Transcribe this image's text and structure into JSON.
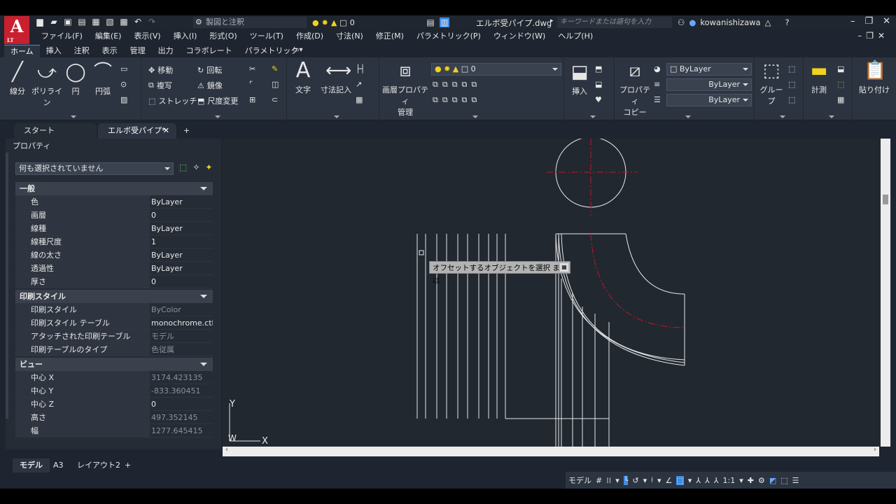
{
  "app": {
    "logo": "A",
    "logo_sub": "LT",
    "workspace": "製図と注釈",
    "layer": "0",
    "file_name": "エルボ受パイプ.dwg",
    "search_placeholder": "キーワードまたは語句を入力",
    "user": "kowanishizawa"
  },
  "menu": [
    "ファイル(F)",
    "編集(E)",
    "表示(V)",
    "挿入(I)",
    "形式(O)",
    "ツール(T)",
    "作成(D)",
    "寸法(N)",
    "修正(M)",
    "パラメトリック(P)",
    "ウィンドウ(W)",
    "ヘルプ(H)"
  ],
  "ribbon_tabs": [
    "ホーム",
    "挿入",
    "注釈",
    "表示",
    "管理",
    "出力",
    "コラボレート",
    "パラメトリック"
  ],
  "ribbon": {
    "draw": {
      "line": "線分",
      "polyline": "ポリライン",
      "circle": "円",
      "arc": "円弧"
    },
    "modify": {
      "move": "移動",
      "rotate": "回転",
      "copy": "複写",
      "mirror": "鏡像",
      "stretch": "ストレッチ",
      "scale": "尺度変更"
    },
    "annotation": {
      "text": "文字",
      "dimension": "寸法記入"
    },
    "layers": {
      "props_l1": "画層プロパティ",
      "props_l2": "管理",
      "current": "0"
    },
    "block": {
      "insert": "挿入"
    },
    "properties": {
      "match_l1": "プロパティ",
      "match_l2": "コピー",
      "color": "ByLayer",
      "linetype": "ByLayer",
      "lineweight": "ByLayer"
    },
    "groups": {
      "group": "グループ"
    },
    "utilities": {
      "measure": "計測"
    },
    "clipboard": {
      "paste": "貼り付け"
    }
  },
  "doc_tabs": [
    "スタート",
    "エルボ受パイプ*"
  ],
  "properties_panel": {
    "title": "プロパティ",
    "selection": "何も選択されていません",
    "sections": [
      {
        "name": "一般",
        "rows": [
          [
            "色",
            "ByLayer"
          ],
          [
            "画層",
            "0"
          ],
          [
            "線種",
            "ByLayer"
          ],
          [
            "線種尺度",
            "1"
          ],
          [
            "線の太さ",
            "ByLayer"
          ],
          [
            "透過性",
            "ByLayer"
          ],
          [
            "厚さ",
            "0"
          ]
        ]
      },
      {
        "name": "印刷スタイル",
        "rows": [
          [
            "印刷スタイル",
            "ByColor"
          ],
          [
            "印刷スタイル テーブル",
            "monochrome.ctb"
          ],
          [
            "アタッチされた印刷テーブル",
            "モデル"
          ],
          [
            "印刷テーブルのタイプ",
            "色従属"
          ]
        ]
      },
      {
        "name": "ビュー",
        "rows": [
          [
            "中心 X",
            "3174.423135"
          ],
          [
            "中心 Y",
            "-833.360451"
          ],
          [
            "中心 Z",
            "0"
          ],
          [
            "高さ",
            "497.352145"
          ],
          [
            "幅",
            "1277.645415"
          ]
        ]
      }
    ]
  },
  "canvas": {
    "tooltip": "オフセットするオブジェクトを選択 または",
    "ucs_x": "X",
    "ucs_y": "Y",
    "ucs_w": "W"
  },
  "layout_tabs": [
    "モデル",
    "A3",
    "レイアウト2"
  ],
  "status": {
    "model": "モデル",
    "scale": "1:1"
  }
}
